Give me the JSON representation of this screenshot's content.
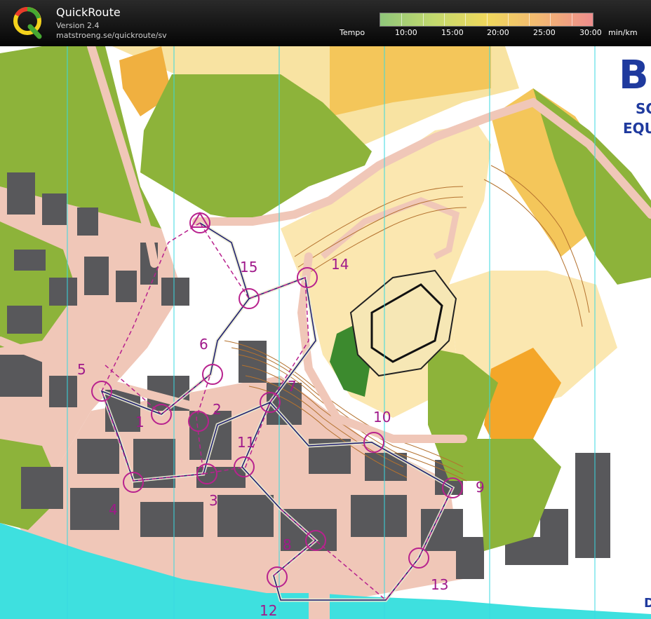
{
  "app": {
    "title": "QuickRoute",
    "version": "Version 2.4",
    "url": "matstroeng.se/quickroute/sv"
  },
  "tempo": {
    "label": "Tempo",
    "ticks": [
      "10:00",
      "15:00",
      "20:00",
      "25:00",
      "30:00"
    ],
    "unit": "min/km",
    "colors": [
      "#8fc67a",
      "#c2d96e",
      "#f0d85c",
      "#f2b872",
      "#ee8d8d"
    ]
  },
  "map": {
    "controls": [
      "1",
      "2",
      "3",
      "4",
      "5",
      "6",
      "7",
      "8",
      "9",
      "10",
      "11",
      "12",
      "13",
      "14",
      "15"
    ],
    "title_fragments": [
      "B",
      "SC",
      "EQU",
      "D"
    ],
    "colors": {
      "open_land": "#f5d98c",
      "rough_open": "#fbe7b0",
      "forest_green": "#8db33a",
      "dark_green": "#3c8a2e",
      "building": "#555557",
      "paved": "#f0c7b8",
      "water": "#3ee0df",
      "course": "#b8228e",
      "route": "#1a1a6e",
      "contour": "#b4722f",
      "highlight_orange": "#f4a629"
    }
  }
}
